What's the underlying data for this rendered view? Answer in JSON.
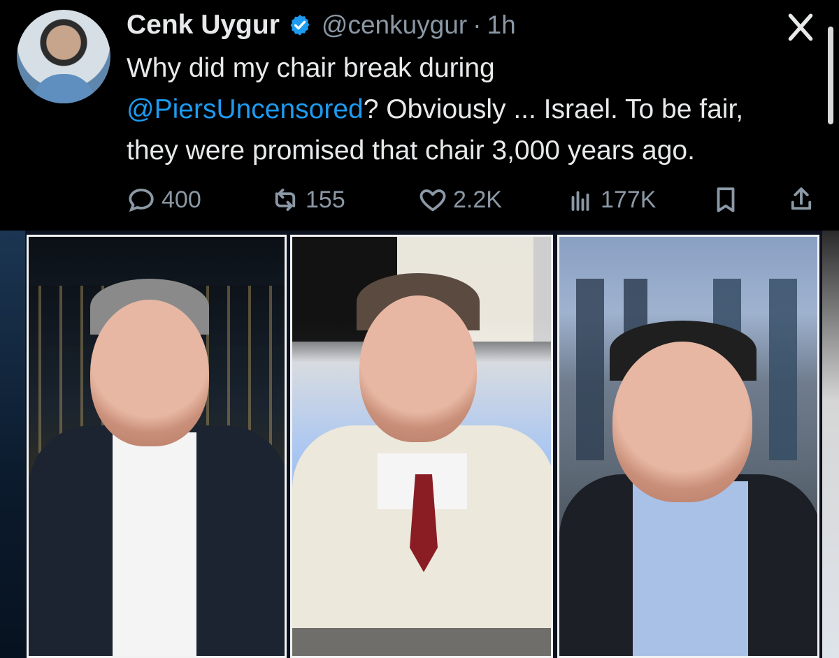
{
  "tweet": {
    "author": {
      "display_name": "Cenk Uygur",
      "handle": "@cenkuygur",
      "time": "1h"
    },
    "text": {
      "line1": "Why did my chair break during",
      "mention": "@PiersUncensored",
      "after_mention": "? Obviously ... Israel. To be fair,",
      "line3": "they were promised that chair 3,000 years ago."
    },
    "actions": {
      "replies": "400",
      "reposts": "155",
      "likes": "2.2K",
      "views": "177K"
    }
  },
  "icons": {
    "verified": "verified-badge-icon",
    "close": "x-close-icon",
    "reply": "reply-icon",
    "repost": "repost-icon",
    "like": "heart-icon",
    "views": "views-icon",
    "bookmark": "bookmark-icon",
    "share": "share-icon"
  },
  "colors": {
    "background": "#000000",
    "text_primary": "#e7e9ea",
    "text_secondary": "#8b98a5",
    "link": "#1d9bf0",
    "verified": "#1d9bf0"
  }
}
